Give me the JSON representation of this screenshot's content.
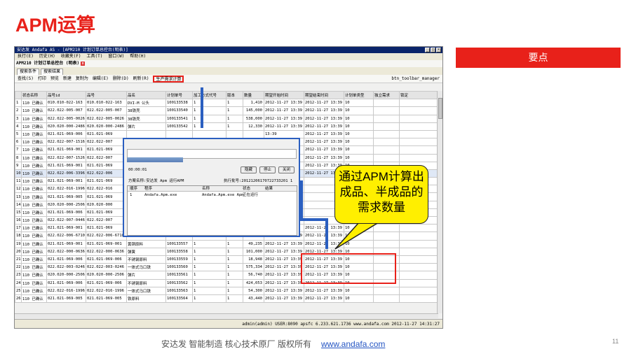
{
  "slide_title": "APM运算",
  "side_badge": "要点",
  "callout": "通过APM计算出成品、半成品的需求数量",
  "footer": {
    "text": "安达发  智能制造 核心技术原厂   版权所有",
    "link": "www.andafa.com"
  },
  "page_number": "11",
  "window": {
    "title": "安达发 Andafa AS - [APM210 计划订单总控台(明表)]",
    "menu": [
      "执行(E)",
      "历史(H)",
      "收藏夹(F)",
      "工具(T)",
      "窗口(W)",
      "帮助(H)"
    ],
    "subtitle": "APM210 计划订单总控台 (明表)",
    "tabs": [
      "搜索条件",
      "搜索结果"
    ],
    "toolbar": [
      "查找(S)",
      "打印",
      "预览",
      "新建",
      "复制为",
      "编辑(E)",
      "删除(D)",
      "刷新(R)"
    ],
    "toolbar_highlight": "生产需求计算",
    "toolbar_right": "btn_toolbar_manager",
    "statusbar": "admin(admin)  USER:8090  apsfc  6.233.621.1736  www.andafa.com  2012-11-27 14:31:27"
  },
  "table": {
    "columns": [
      "",
      "状态名称",
      "品号id",
      "品号",
      "品名",
      "计划单号",
      "加工方式代号",
      "版本",
      "数量",
      "期望开始时间",
      "期望结束时间",
      "计划单类型",
      "独立需求",
      "锁定"
    ],
    "rows": [
      [
        "1",
        "110 已确认",
        "010.010-022-163",
        "010.010-022-163",
        "DVI-M 公头",
        "100133538",
        "1",
        "1",
        "1,410",
        "2012-11-27 13:39",
        "2012-11-27 13:39",
        "10",
        "",
        ""
      ],
      [
        "2",
        "110 已确认",
        "022.022-005-007",
        "022.022-005-007",
        "38铁壳",
        "100133540",
        "1",
        "1",
        "145,000",
        "2012-11-27 13:39",
        "2012-11-27 13:39",
        "10",
        "",
        ""
      ],
      [
        "3",
        "110 已确认",
        "022.022-005-0026",
        "022.022-005-0026",
        "38铁壳",
        "100133541",
        "1",
        "1",
        "538,000",
        "2012-11-27 13:39",
        "2012-11-27 13:39",
        "10",
        "",
        ""
      ],
      [
        "4",
        "110 已确认",
        "020.020-000-2486",
        "020.020-000-2486",
        "弹片",
        "100133542",
        "1",
        "1",
        "12,330",
        "2012-11-27 13:39",
        "2012-11-27 13:39",
        "10",
        "",
        ""
      ],
      [
        "5",
        "110 已确认",
        "021.021-069-006",
        "021.021-069",
        "",
        "",
        "",
        "",
        "",
        "13:39",
        "2012-11-27 13:39",
        "10",
        "",
        ""
      ],
      [
        "6",
        "110 已确认",
        "022.022-007-1516",
        "022.022-007",
        "",
        "",
        "",
        "",
        "",
        "13:39",
        "2012-11-27 13:39",
        "10",
        "",
        ""
      ],
      [
        "7",
        "110 已确认",
        "021.021-069-001",
        "021.021-069",
        "",
        "",
        "",
        "",
        "",
        "13:39",
        "2012-11-27 13:39",
        "10",
        "",
        ""
      ],
      [
        "8",
        "110 已确认",
        "022.022-007-1526",
        "022.022-007",
        "",
        "",
        "",
        "",
        "",
        "13:39",
        "2012-11-27 13:39",
        "10",
        "",
        ""
      ],
      [
        "9",
        "110 已确认",
        "021.021-069-001",
        "021.021-069",
        "",
        "",
        "",
        "",
        "",
        "13:39",
        "2012-11-27 13:39",
        "10",
        "",
        ""
      ],
      [
        "10",
        "110 已确认",
        "022.022-006-3396",
        "022.022-006",
        "",
        "",
        "",
        "",
        "",
        "13:39",
        "2012-11-27 13:39",
        "10",
        "",
        ""
      ],
      [
        "11",
        "110 已确认",
        "021.021-069-001",
        "021.021-069",
        "",
        "",
        "",
        "",
        "",
        "13:39",
        "",
        "",
        "",
        ""
      ],
      [
        "12",
        "110 已确认",
        "022.022-016-1996",
        "022.022-016",
        "",
        "",
        "",
        "",
        "",
        "13:39",
        "",
        "",
        "",
        ""
      ],
      [
        "13",
        "110 已确认",
        "021.021-069-005",
        "021.021-069",
        "",
        "",
        "",
        "",
        "",
        "13:39",
        "",
        "",
        "",
        ""
      ],
      [
        "14",
        "110 已确认",
        "020.020-000-2506",
        "020.020-000",
        "",
        "",
        "",
        "",
        "",
        "13:39",
        "",
        "",
        "",
        ""
      ],
      [
        "15",
        "110 已确认",
        "021.021-069-006",
        "021.021-069",
        "",
        "",
        "",
        "",
        "",
        "13:39",
        "",
        "",
        "",
        ""
      ],
      [
        "16",
        "110 已确认",
        "022.022-007-0446",
        "022.022-007",
        "",
        "",
        "",
        "",
        "",
        "13:39",
        "",
        "",
        "",
        ""
      ],
      [
        "17",
        "110 已确认",
        "021.021-069-001",
        "021.021-069",
        "",
        "",
        "",
        "",
        "",
        "13:39",
        "2012-11-27 13:39",
        "10",
        "",
        ""
      ],
      [
        "18",
        "110 已确认",
        "022.022-006-6710",
        "022.022-006-6710",
        "",
        "100133556",
        "1",
        "1",
        "50,000",
        "2012-11-27 13:39",
        "2012-11-27 13:39",
        "10",
        "",
        ""
      ],
      [
        "19",
        "110 已确认",
        "021.021-069-001",
        "021.021-069-001",
        "黄铜原料",
        "100133557",
        "1",
        "1",
        "49,235",
        "2012-11-27 13:39",
        "2012-11-27 13:39",
        "10",
        "",
        ""
      ],
      [
        "20",
        "110 已确认",
        "022.022-000-0636",
        "022.022-000-0636",
        "弹簧",
        "100133558",
        "1",
        "1",
        "101,000",
        "2012-11-27 13:39",
        "2012-11-27 13:39",
        "10",
        "",
        ""
      ],
      [
        "21",
        "110 已确认",
        "021.021-069-006",
        "021.021-069-006",
        "不锈钢原料",
        "100133559",
        "1",
        "1",
        "18,948",
        "2012-11-27 13:39",
        "2012-11-27 13:39",
        "10",
        "",
        ""
      ],
      [
        "22",
        "110 已确认",
        "022.022-003-0246",
        "022.022-003-0246",
        "一体式马口铁",
        "100133560",
        "1",
        "1",
        "575,334",
        "2012-11-27 13:39",
        "2012-11-27 13:39",
        "10",
        "",
        ""
      ],
      [
        "23",
        "110 已确认",
        "020.020-000-2506",
        "020.020-000-2506",
        "弹片",
        "100133561",
        "1",
        "1",
        "56,740",
        "2012-11-27 13:39",
        "2012-11-27 13:39",
        "10",
        "",
        ""
      ],
      [
        "24",
        "110 已确认",
        "021.021-069-006",
        "021.021-069-006",
        "不锈钢原料",
        "100133562",
        "1",
        "1",
        "424,053",
        "2012-11-27 13:39",
        "2012-11-27 13:39",
        "10",
        "",
        ""
      ],
      [
        "25",
        "110 已确认",
        "022.022-016-1996",
        "022.022-016-1996",
        "一体式马口铁",
        "100133563",
        "1",
        "1",
        "54,300",
        "2012-11-27 13:39",
        "2012-11-27 13:39",
        "10",
        "",
        ""
      ],
      [
        "26",
        "110 已确认",
        "021.021-069-005",
        "021.021-069-005",
        "铁原料",
        "100133564",
        "1",
        "1",
        "43,440",
        "2012-11-27 13:39",
        "2012-11-27 13:39",
        "10",
        "",
        ""
      ]
    ]
  },
  "dialog": {
    "time": "00:00:01",
    "buttons": [
      "隐藏",
      "停止",
      "关闭"
    ],
    "plan": "方案名称:安达发 Apm 运行APM",
    "exec_no": "执行批号:20121206170722733201 1",
    "grid_headers": [
      "顺序",
      "程序",
      "名称",
      "状态",
      "结果"
    ],
    "grid_row": [
      "1",
      "Andafa.Apm.exe",
      "Andafa.Apm.exe Apm",
      "正在运行",
      ""
    ]
  }
}
